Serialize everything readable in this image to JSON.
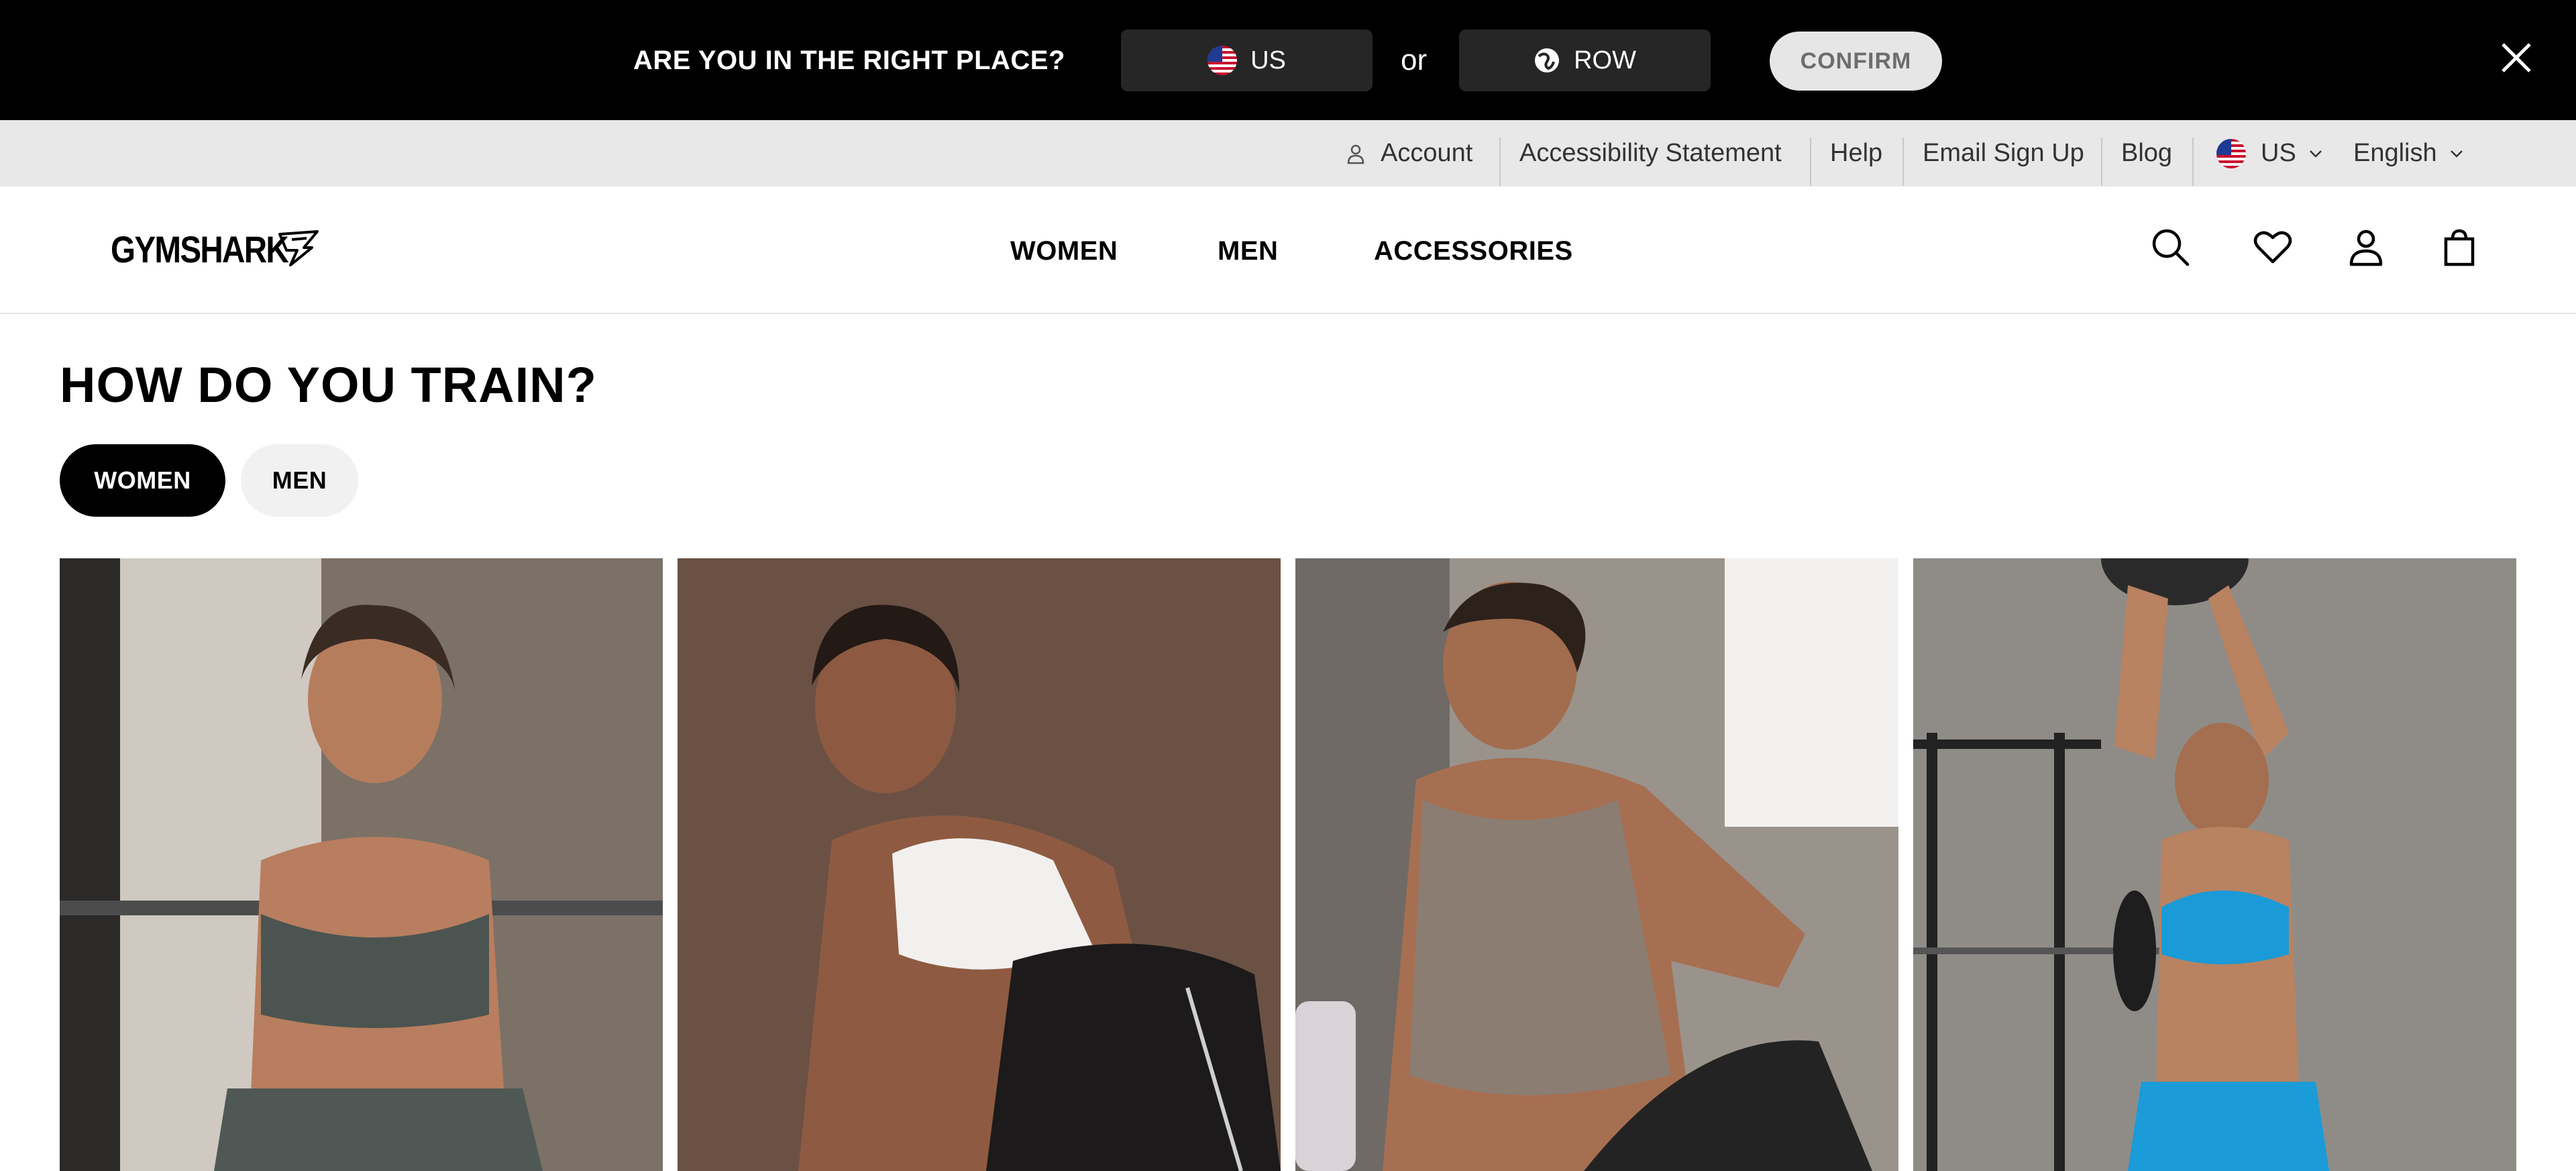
{
  "banner": {
    "title": "ARE YOU IN THE RIGHT PLACE?",
    "us_label": "US",
    "or_text": "or",
    "row_label": "ROW",
    "confirm_label": "CONFIRM",
    "close_icon": "close-icon"
  },
  "utility": {
    "account": "Account",
    "accessibility": "Accessibility Statement",
    "help": "Help",
    "email": "Email Sign Up",
    "blog": "Blog",
    "region": "US",
    "language": "English"
  },
  "header": {
    "logo": "GYMSHARK",
    "nav": [
      "WOMEN",
      "MEN",
      "ACCESSORIES"
    ],
    "icons": [
      "search-icon",
      "heart-icon",
      "account-icon",
      "bag-icon"
    ]
  },
  "main": {
    "title": "HOW DO YOU TRAIN?",
    "toggle": [
      "WOMEN",
      "MEN"
    ],
    "selected_toggle": "WOMEN",
    "cards": [
      "card-1",
      "card-2",
      "card-3",
      "card-4"
    ]
  },
  "colors": {
    "banner_bg": "#000000",
    "utility_bg": "#e8e8e8",
    "accent": "#000000",
    "confirm_bg": "#e6e6e6"
  }
}
